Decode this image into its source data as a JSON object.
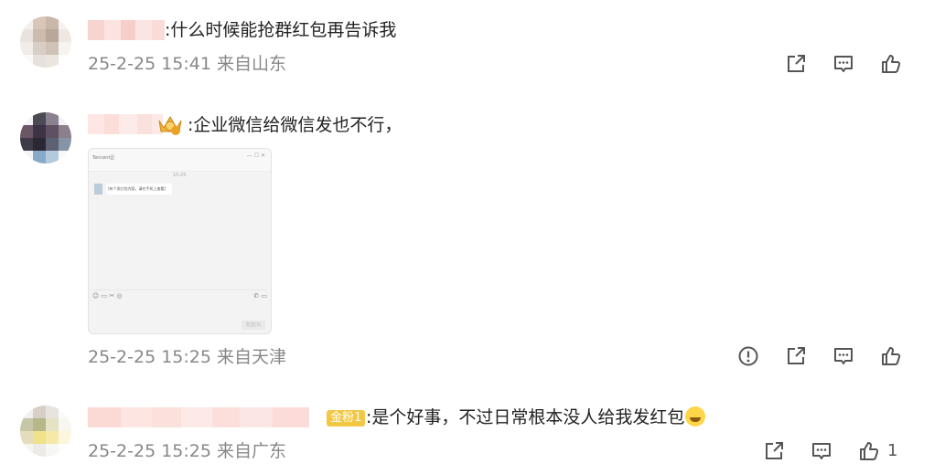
{
  "comments": [
    {
      "text": ":什么时候能抢群红包再告诉我",
      "meta": "25-2-25 15:41 来自山东",
      "avatar_colors": [
        "#f3f0ee",
        "#d8c6b8",
        "#c9b7a8",
        "#f5f2ef",
        "#eae2dc",
        "#cdbbad",
        "#b9a79a",
        "#efe8e2",
        "#f1ece8",
        "#d9cdc4",
        "#cfc2b6",
        "#f6f3f0",
        "#fbfaf9",
        "#e8e1db",
        "#ebe5e0",
        "#fdfdfc"
      ],
      "name_colors": [
        "#f8d4d0",
        "#fbe3e0",
        "#f7cfca",
        "#fbe5e2",
        "#f9dcd8"
      ],
      "actions": [
        "share-icon",
        "comment-icon",
        "like-icon"
      ]
    },
    {
      "text": ":企业微信给微信发也不行，",
      "meta": "25-2-25 15:25 来自天津",
      "avatar_colors": [
        "#f4f3f3",
        "#4b4a55",
        "#8a8290",
        "#f2f2f2",
        "#6a5665",
        "#3c3344",
        "#5f5161",
        "#8b7f8c",
        "#3f3a47",
        "#2c2833",
        "#5c6174",
        "#8594a6",
        "#f2f5f8",
        "#87aac9",
        "#b4c9db",
        "#f7f9fb"
      ],
      "name_colors": [
        "#fde6e4",
        "#fbdeda",
        "#fcebe9",
        "#fbe1dd",
        "#fde9e7"
      ],
      "image": {
        "title": "Tencent企",
        "time": "15:25",
        "message": "[有个发红包内容，请在手机上查看]",
        "send": "发送(S)"
      },
      "actions": [
        "report-icon",
        "share-icon",
        "comment-icon",
        "like-icon"
      ]
    },
    {
      "text": ":是个好事，不过日常根本没人给我发红包",
      "meta": "25-2-25 15:25 来自广东",
      "badge": "金粉1",
      "avatar_colors": [
        "#f1efef",
        "#d8cfc6",
        "#e7e3df",
        "#fafafa",
        "#c7c6a6",
        "#b7b88a",
        "#e6e2c5",
        "#f8f7ef",
        "#e4dcbc",
        "#f0e28a",
        "#f5e9a8",
        "#fbf6dc",
        "#f6f4ef",
        "#ecebe8",
        "#f7f7f5",
        "#fdfdfd"
      ],
      "name_colors": [
        "#fbd9d5",
        "#fde5e2",
        "#fbe0dc",
        "#fde9e7",
        "#fcdfdb",
        "#fbe6e3",
        "#fcdcd8"
      ],
      "like_count": "1",
      "actions": [
        "share-icon",
        "comment-icon",
        "like-icon"
      ]
    }
  ],
  "icons": {
    "share": "share-icon",
    "comment": "comment-icon",
    "like": "like-icon",
    "report": "report-icon"
  },
  "colors": {
    "badge": "#f2c744",
    "meta": "#888888",
    "icon": "#555555"
  }
}
